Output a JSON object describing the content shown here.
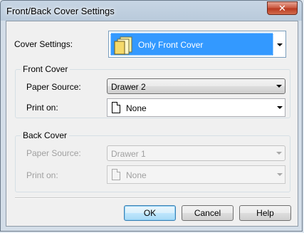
{
  "window": {
    "title": "Front/Back Cover Settings",
    "close_glyph": "✕"
  },
  "cover_settings": {
    "label": "Cover Settings:",
    "value": "Only Front Cover",
    "icon": "cover-stack-icon"
  },
  "front_cover": {
    "title": "Front Cover",
    "paper_source_label": "Paper Source:",
    "paper_source_value": "Drawer 2",
    "print_on_label": "Print on:",
    "print_on_value": "None"
  },
  "back_cover": {
    "title": "Back Cover",
    "paper_source_label": "Paper Source:",
    "paper_source_value": "Drawer 1",
    "print_on_label": "Print on:",
    "print_on_value": "None",
    "enabled": false
  },
  "buttons": {
    "ok": "OK",
    "cancel": "Cancel",
    "help": "Help"
  },
  "colors": {
    "selection": "#3399ff",
    "disabled_text": "#a0a0a0"
  }
}
